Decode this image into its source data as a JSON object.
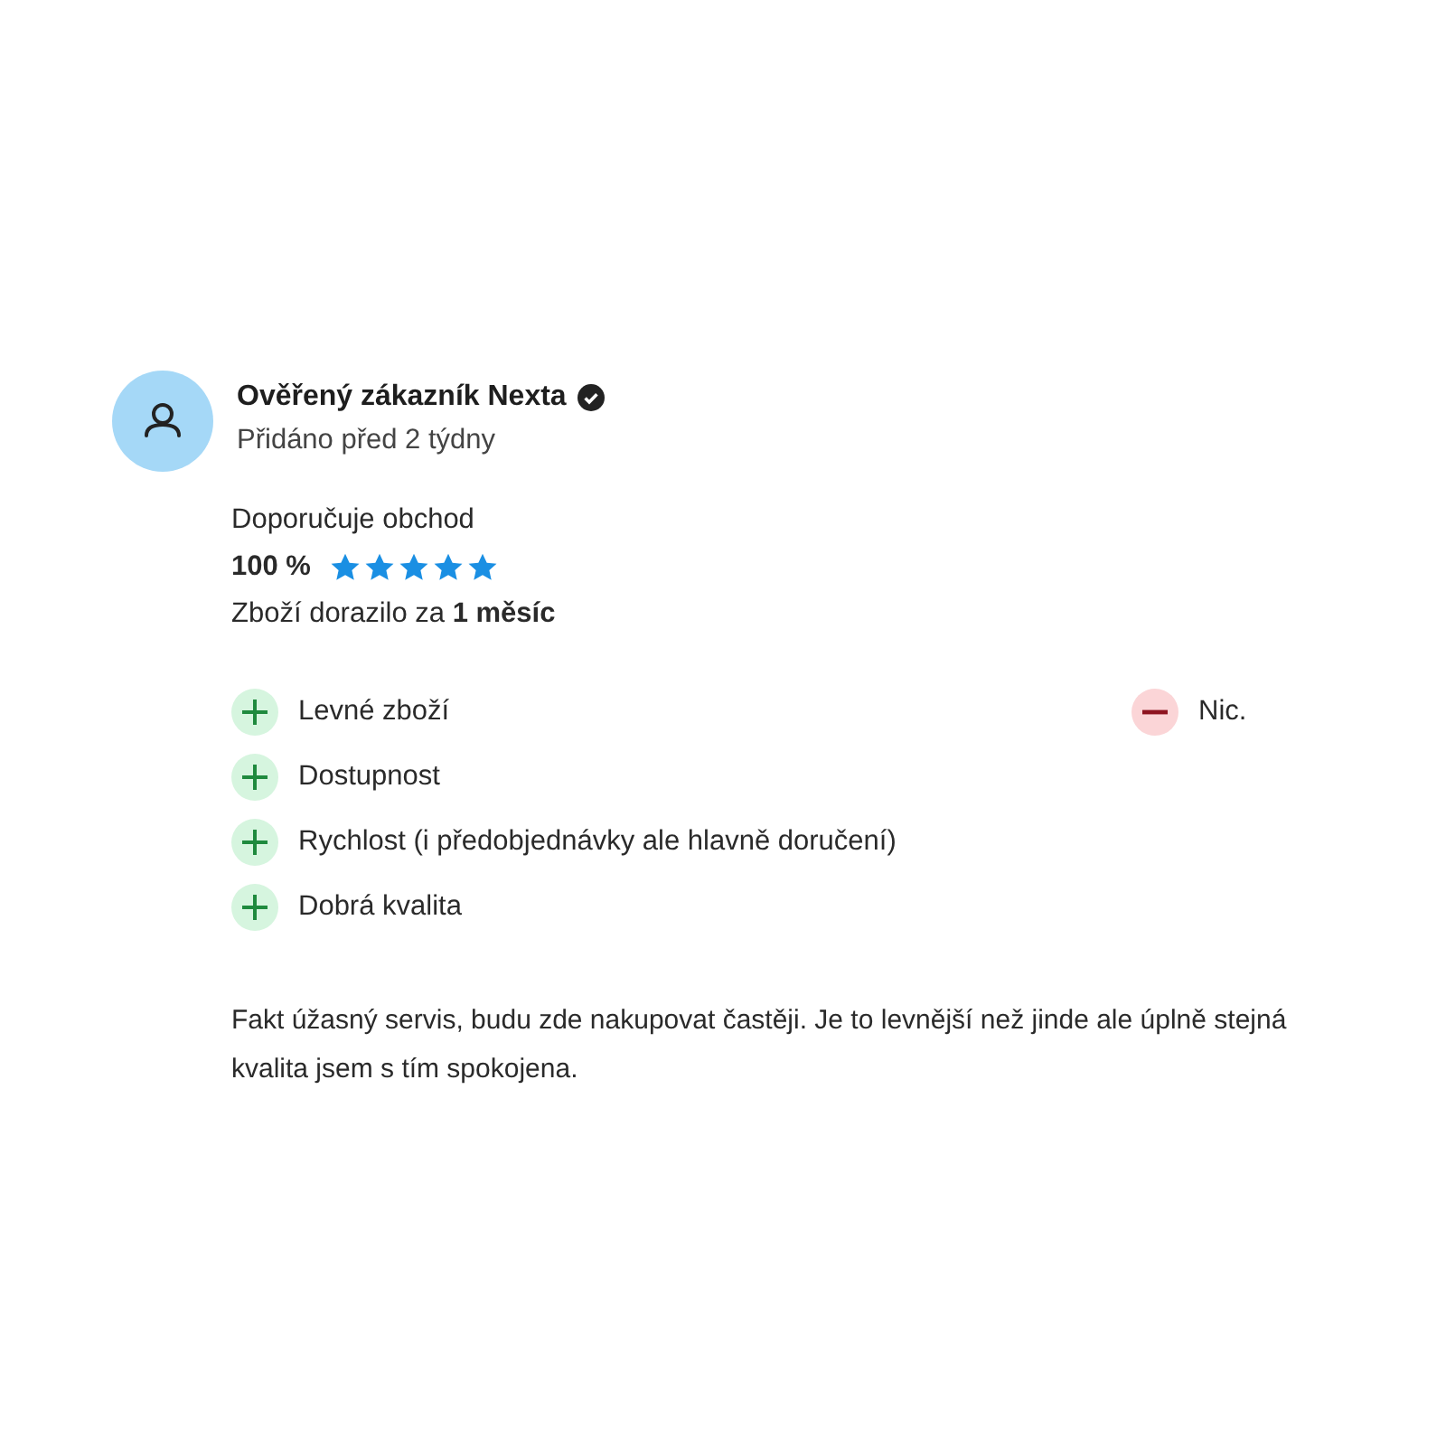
{
  "review": {
    "author": "Ověřený zákazník Nexta",
    "verified": true,
    "added": "Přidáno před 2 týdny",
    "recommend": "Doporučuje obchod",
    "percent": "100 %",
    "stars": 5,
    "delivery": "Zboží dorazilo za **1 měsíc**",
    "pros": [
      {
        "text": "Levné zboží"
      },
      {
        "text": "Dostupnost"
      },
      {
        "text": "Rychlost (i předobjednávky ale hlavně doručení)"
      },
      {
        "text": "Dobrá kvalita"
      }
    ],
    "cons": [
      {
        "text": "Nic."
      }
    ],
    "comment": "Fakt úžasný servis, budu zde nakupovat častěji. Je to levnější než jinde ale úplně stejná kvalita jsem s tím spokojena."
  }
}
